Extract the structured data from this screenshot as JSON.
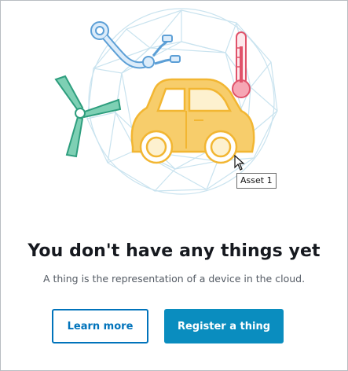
{
  "empty_state": {
    "title": "You don't have any things yet",
    "description": "A thing is the representation of a device in the cloud."
  },
  "actions": {
    "learn_more_label": "Learn more",
    "register_label": "Register a thing"
  },
  "tooltip": {
    "text": "Asset 1"
  },
  "illustration": {
    "icons": [
      "robot-arm-icon",
      "thermometer-icon",
      "wind-turbine-icon",
      "car-icon",
      "network-sphere-icon"
    ]
  },
  "colors": {
    "primary_blue": "#0a8dbf",
    "link_blue": "#0073bb",
    "title_text": "#16191f",
    "body_text": "#545b64",
    "car_yellow": "#f7cd6b",
    "car_stroke": "#f2b632",
    "turbine_green": "#2e9e7e",
    "robot_blue": "#5c9fd6",
    "thermo_red": "#e0526a",
    "sphere_line": "#c9e3ef"
  }
}
